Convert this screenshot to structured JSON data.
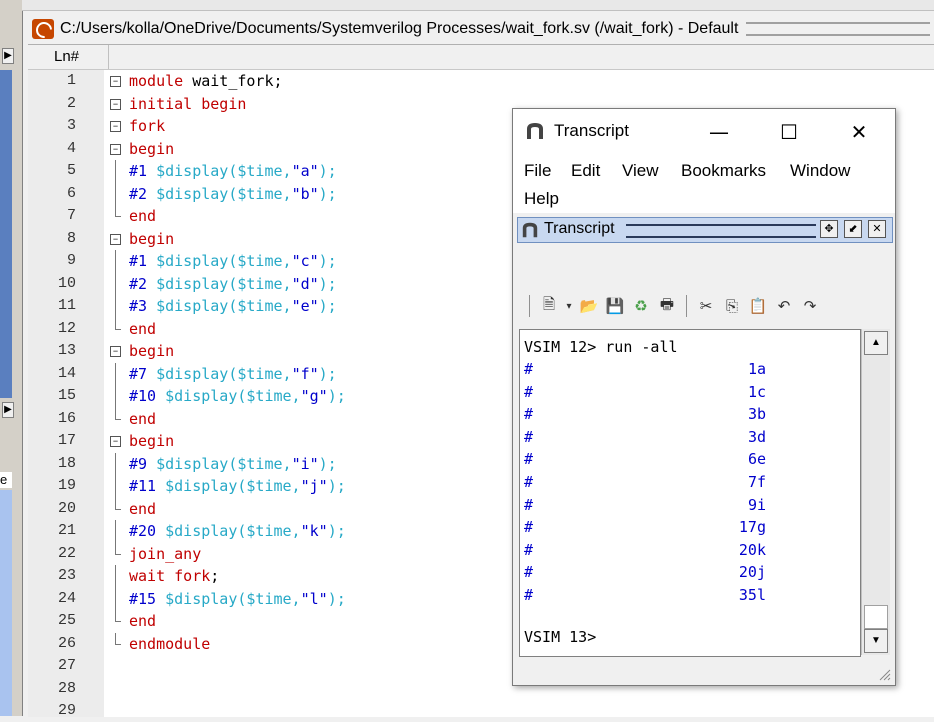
{
  "editor": {
    "title": "C:/Users/kolla/OneDrive/Documents/Systemverilog Processes/wait_fork.sv (/wait_fork) - Default",
    "ln_header": "Ln#",
    "lines": [
      {
        "n": "1",
        "parts": [
          [
            "kw",
            "module"
          ],
          [
            "tx",
            " wait_fork;"
          ]
        ]
      },
      {
        "n": "2",
        "parts": [
          [
            "kw",
            "initial begin"
          ]
        ]
      },
      {
        "n": "3",
        "parts": [
          [
            "kw",
            "fork"
          ]
        ]
      },
      {
        "n": "4",
        "parts": [
          [
            "kw",
            "begin"
          ]
        ]
      },
      {
        "n": "5",
        "parts": [
          [
            "num",
            "#1"
          ],
          [
            "tx",
            " "
          ],
          [
            "sys",
            "$display($time,"
          ],
          [
            "str",
            "\"a\""
          ],
          [
            "sys",
            ");"
          ]
        ]
      },
      {
        "n": "6",
        "parts": [
          [
            "num",
            "#2"
          ],
          [
            "tx",
            " "
          ],
          [
            "sys",
            "$display($time,"
          ],
          [
            "str",
            "\"b\""
          ],
          [
            "sys",
            ");"
          ]
        ]
      },
      {
        "n": "7",
        "parts": [
          [
            "kw",
            "end"
          ]
        ]
      },
      {
        "n": "8",
        "parts": [
          [
            "kw",
            "begin"
          ]
        ]
      },
      {
        "n": "9",
        "parts": [
          [
            "num",
            "#1"
          ],
          [
            "tx",
            " "
          ],
          [
            "sys",
            "$display($time,"
          ],
          [
            "str",
            "\"c\""
          ],
          [
            "sys",
            ");"
          ]
        ]
      },
      {
        "n": "10",
        "parts": [
          [
            "num",
            "#2"
          ],
          [
            "tx",
            " "
          ],
          [
            "sys",
            "$display($time,"
          ],
          [
            "str",
            "\"d\""
          ],
          [
            "sys",
            ");"
          ]
        ]
      },
      {
        "n": "11",
        "parts": [
          [
            "num",
            "#3"
          ],
          [
            "tx",
            " "
          ],
          [
            "sys",
            "$display($time,"
          ],
          [
            "str",
            "\"e\""
          ],
          [
            "sys",
            ");"
          ]
        ]
      },
      {
        "n": "12",
        "parts": [
          [
            "kw",
            "end"
          ]
        ]
      },
      {
        "n": "13",
        "parts": [
          [
            "kw",
            "begin"
          ]
        ]
      },
      {
        "n": "14",
        "parts": [
          [
            "num",
            "#7"
          ],
          [
            "tx",
            " "
          ],
          [
            "sys",
            "$display($time,"
          ],
          [
            "str",
            "\"f\""
          ],
          [
            "sys",
            ");"
          ]
        ]
      },
      {
        "n": "15",
        "parts": [
          [
            "num",
            "#10"
          ],
          [
            "tx",
            " "
          ],
          [
            "sys",
            "$display($time,"
          ],
          [
            "str",
            "\"g\""
          ],
          [
            "sys",
            ");"
          ]
        ]
      },
      {
        "n": "16",
        "parts": [
          [
            "kw",
            "end"
          ]
        ]
      },
      {
        "n": "17",
        "parts": [
          [
            "kw",
            "begin"
          ]
        ]
      },
      {
        "n": "18",
        "parts": [
          [
            "num",
            "#9"
          ],
          [
            "tx",
            " "
          ],
          [
            "sys",
            "$display($time,"
          ],
          [
            "str",
            "\"i\""
          ],
          [
            "sys",
            ");"
          ]
        ]
      },
      {
        "n": "19",
        "parts": [
          [
            "num",
            "#11"
          ],
          [
            "tx",
            " "
          ],
          [
            "sys",
            "$display($time,"
          ],
          [
            "str",
            "\"j\""
          ],
          [
            "sys",
            ");"
          ]
        ]
      },
      {
        "n": "20",
        "parts": [
          [
            "kw",
            "end"
          ]
        ]
      },
      {
        "n": "21",
        "parts": [
          [
            "num",
            "#20"
          ],
          [
            "tx",
            " "
          ],
          [
            "sys",
            "$display($time,"
          ],
          [
            "str",
            "\"k\""
          ],
          [
            "sys",
            ");"
          ]
        ]
      },
      {
        "n": "22",
        "parts": [
          [
            "kw",
            "join_any"
          ]
        ]
      },
      {
        "n": "23",
        "parts": [
          [
            "kw",
            "wait fork"
          ],
          [
            "tx",
            ";"
          ]
        ]
      },
      {
        "n": "24",
        "parts": [
          [
            "num",
            "#15"
          ],
          [
            "tx",
            " "
          ],
          [
            "sys",
            "$display($time,"
          ],
          [
            "str",
            "\"l\""
          ],
          [
            "sys",
            ");"
          ]
        ]
      },
      {
        "n": "25",
        "parts": [
          [
            "kw",
            "end"
          ]
        ]
      },
      {
        "n": "26",
        "parts": [
          [
            "kw",
            "endmodule"
          ]
        ]
      },
      {
        "n": "27",
        "parts": []
      },
      {
        "n": "28",
        "parts": []
      },
      {
        "n": "29",
        "parts": []
      }
    ]
  },
  "transcript": {
    "title": "Transcript",
    "min_glyph": "—",
    "max_glyph": "☐",
    "close_glyph": "✕",
    "menu": [
      "File",
      "Edit",
      "View",
      "Bookmarks",
      "Window",
      "Help"
    ],
    "dock_title": "Transcript",
    "console_prompt1": "VSIM 12> run -all",
    "console_rows": [
      {
        "hash": "#",
        "value": "1a"
      },
      {
        "hash": "#",
        "value": "1c"
      },
      {
        "hash": "#",
        "value": "3b"
      },
      {
        "hash": "#",
        "value": "3d"
      },
      {
        "hash": "#",
        "value": "6e"
      },
      {
        "hash": "#",
        "value": "7f"
      },
      {
        "hash": "#",
        "value": "9i"
      },
      {
        "hash": "#",
        "value": "17g"
      },
      {
        "hash": "#",
        "value": "20k"
      },
      {
        "hash": "#",
        "value": "20j"
      },
      {
        "hash": "#",
        "value": "35l"
      }
    ],
    "console_prompt2": "VSIM 13>"
  },
  "colors": {
    "keyword": "#c00000",
    "number": "#0000cc",
    "system_task": "#27a9c7",
    "string": "#0000cc"
  }
}
